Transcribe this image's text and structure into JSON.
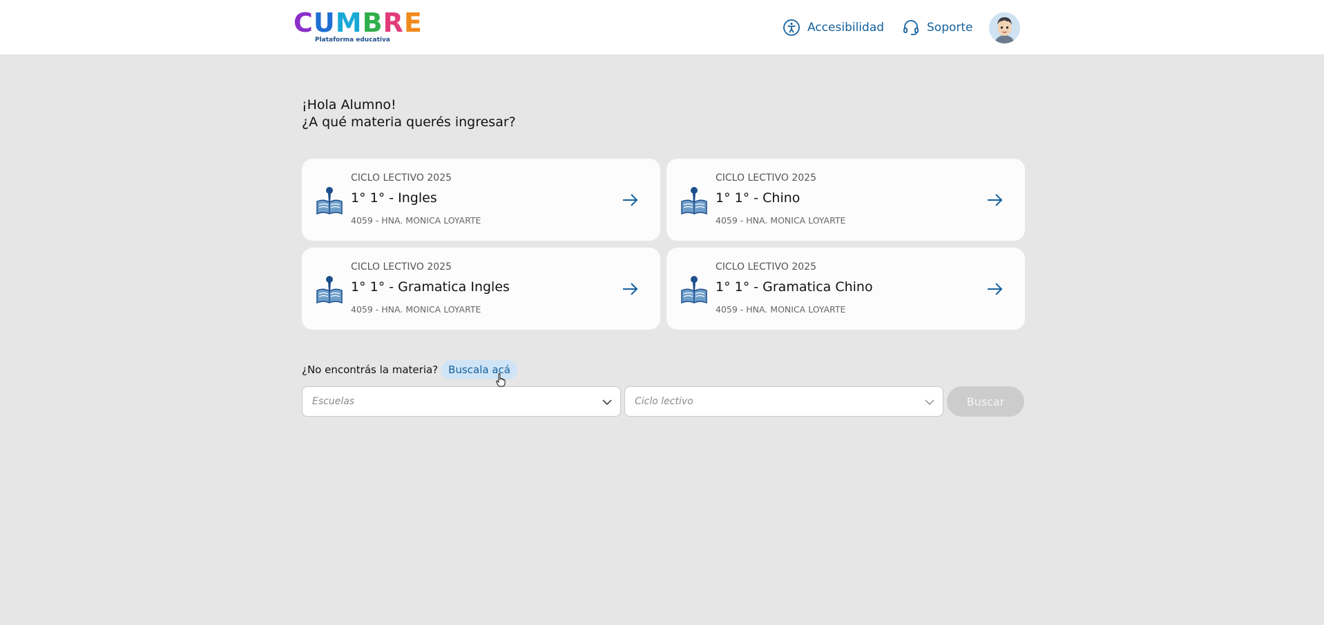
{
  "header": {
    "logo_letters": [
      {
        "char": "C",
        "color": "#8b2fc9"
      },
      {
        "char": "U",
        "color": "#1f6fd1"
      },
      {
        "char": "M",
        "color": "#19a8d6"
      },
      {
        "char": "B",
        "color": "#2fae4a"
      },
      {
        "char": "R",
        "color": "#e13b7a"
      },
      {
        "char": "E",
        "color": "#f08a1d"
      }
    ],
    "logo_subtitle": "Plataforma educativa",
    "accessibility_label": "Accesibilidad",
    "support_label": "Soporte"
  },
  "greeting": {
    "line1": "¡Hola Alumno!",
    "line2": "¿A qué materia querés ingresar?"
  },
  "subjects": [
    {
      "cycle": "CICLO LECTIVO 2025",
      "title": "1° 1° - Ingles",
      "school": "4059 - HNA. MONICA LOYARTE"
    },
    {
      "cycle": "CICLO LECTIVO 2025",
      "title": "1° 1° - Chino",
      "school": "4059 - HNA. MONICA LOYARTE"
    },
    {
      "cycle": "CICLO LECTIVO 2025",
      "title": "1° 1° - Gramatica Ingles",
      "school": "4059 - HNA. MONICA LOYARTE"
    },
    {
      "cycle": "CICLO LECTIVO 2025",
      "title": "1° 1° - Gramatica Chino",
      "school": "4059 - HNA. MONICA LOYARTE"
    }
  ],
  "search": {
    "question": "¿No encontrás la materia?",
    "link_label": "Buscala acá",
    "school_placeholder": "Escuelas",
    "cycle_placeholder": "Ciclo lectivo",
    "button_label": "Buscar"
  },
  "colors": {
    "accent": "#13609e",
    "background": "#e6e6e6",
    "card": "#fcfcfc",
    "disabled_button": "#cccccc"
  }
}
